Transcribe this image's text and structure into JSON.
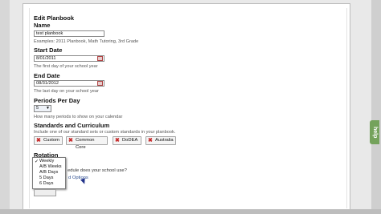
{
  "form": {
    "title": "Edit Planbook",
    "name_label": "Name",
    "name_value": "test planbook",
    "name_hint": "Examples: 2011 Planbook, Math Tutoring, 3rd Grade",
    "start_label": "Start Date",
    "start_value": "8/01/2011",
    "start_hint": "The first day of your school year",
    "end_label": "End Date",
    "end_value": "08/31/2012",
    "end_hint": "The last day on your school year",
    "periods_label": "Periods Per Day",
    "periods_value": "5",
    "periods_hint": "How many periods to show on your calendar",
    "standards_label": "Standards and Curriculum",
    "standards_hint": "Include one of our standard sets or custom standards in your planbook.",
    "standards_buttons": [
      "Custom",
      "Common Core",
      "DoDEA",
      "Australia"
    ],
    "rotation_label": "Rotation",
    "rotation_options": [
      "Weekly",
      "A/B Weeks",
      "A/B Days",
      "5 Days",
      "6 Days"
    ],
    "rotation_selected": "Weekly",
    "rotation_question_fragment": "edule does your school use?",
    "advanced_link": "d Options"
  },
  "help_tab": "help"
}
